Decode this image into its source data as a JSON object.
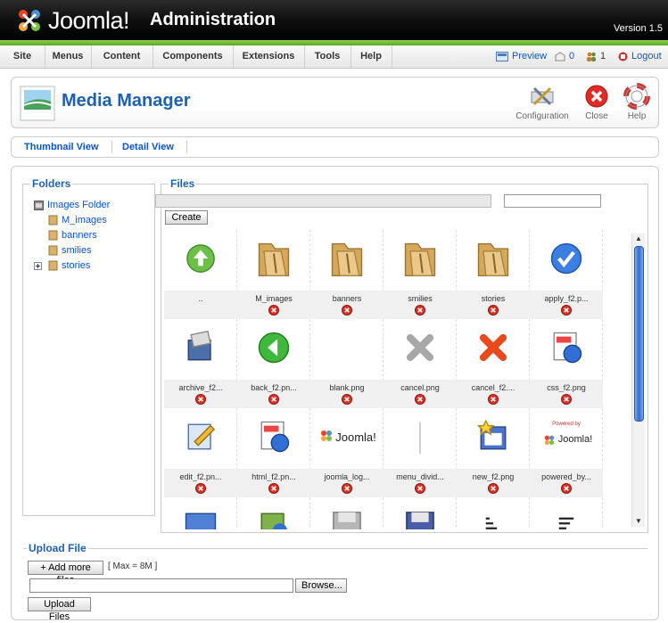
{
  "header": {
    "logo_text": "Joomla!",
    "title": "Administration",
    "version": "Version 1.5"
  },
  "menu": [
    "Site",
    "Menus",
    "Content",
    "Components",
    "Extensions",
    "Tools",
    "Help"
  ],
  "status": {
    "preview": "Preview",
    "messages_count": "0",
    "users_count": "1",
    "logout": "Logout"
  },
  "toolbar": {
    "page_title": "Media Manager",
    "configuration": "Configuration",
    "close": "Close",
    "help": "Help"
  },
  "submenu": [
    "Thumbnail View",
    "Detail View"
  ],
  "folders": {
    "legend": "Folders",
    "root": "Images Folder",
    "items": [
      "M_images",
      "banners",
      "smilies",
      "stories"
    ]
  },
  "files": {
    "legend": "Files",
    "create_button": "Create",
    "items": [
      {
        "name": "..",
        "icon": "up-arrow-icon"
      },
      {
        "name": "M_images",
        "icon": "folder-icon"
      },
      {
        "name": "banners",
        "icon": "folder-icon"
      },
      {
        "name": "smilies",
        "icon": "folder-icon"
      },
      {
        "name": "stories",
        "icon": "folder-icon"
      },
      {
        "name": "apply_f2.p...",
        "icon": "checkmark-icon"
      },
      {
        "name": "archive_f2...",
        "icon": "archive-icon"
      },
      {
        "name": "back_f2.pn...",
        "icon": "back-arrow-icon"
      },
      {
        "name": "blank.png",
        "icon": "blank-icon"
      },
      {
        "name": "cancel.png",
        "icon": "grey-x-icon"
      },
      {
        "name": "cancel_f2....",
        "icon": "red-x-icon"
      },
      {
        "name": "css_f2.png",
        "icon": "css-icon"
      },
      {
        "name": "edit_f2.pn...",
        "icon": "edit-icon"
      },
      {
        "name": "html_f2.pn...",
        "icon": "html-icon"
      },
      {
        "name": "joomla_log...",
        "icon": "joomla-logo-icon"
      },
      {
        "name": "menu_divid...",
        "icon": "divider-icon"
      },
      {
        "name": "new_f2.png",
        "icon": "new-icon"
      },
      {
        "name": "powered_by...",
        "icon": "powered-by-icon"
      },
      {
        "name": "",
        "icon": "monitor-icon"
      },
      {
        "name": "",
        "icon": "publish-icon"
      },
      {
        "name": "",
        "icon": "save-grey-icon"
      },
      {
        "name": "",
        "icon": "save-icon"
      },
      {
        "name": "",
        "icon": "sort-asc-icon"
      },
      {
        "name": "",
        "icon": "sort-desc-icon"
      }
    ]
  },
  "upload": {
    "legend": "Upload File",
    "add_more": "+ Add more files",
    "max": "[ Max = 8M ]",
    "browse": "Browse...",
    "upload_button": "Upload Files"
  }
}
